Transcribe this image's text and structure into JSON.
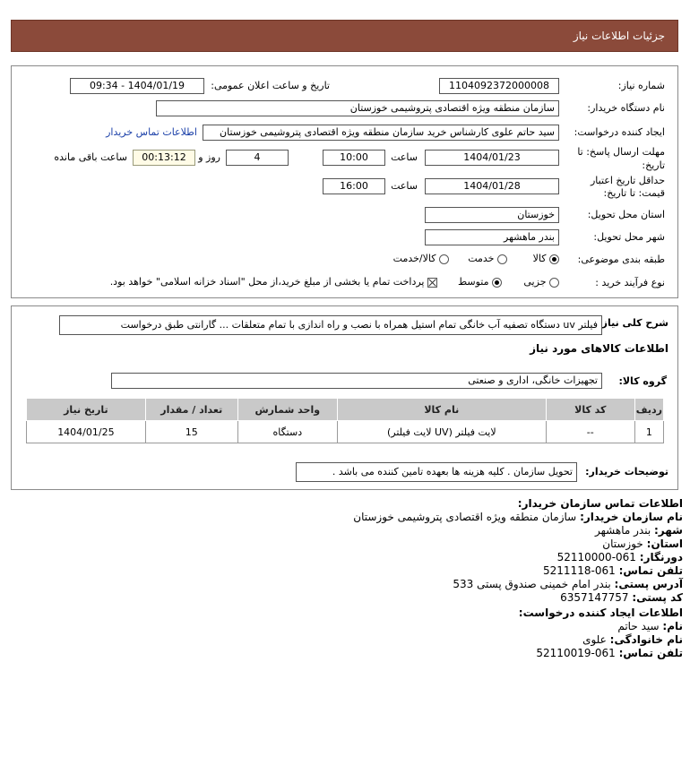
{
  "header": {
    "title": "جزئیات اطلاعات نیاز"
  },
  "details": {
    "need_number_label": "شماره نیاز:",
    "need_number": "1104092372000008",
    "announce_label": "تاریخ و ساعت اعلان عمومی:",
    "announce_value": "1404/01/19 - 09:34",
    "buyer_org_label": "نام دستگاه خریدار:",
    "buyer_org": "سازمان منطقه ویژه اقتصادی پتروشیمی خوزستان",
    "creator_label": "ایجاد کننده درخواست:",
    "creator": "سید حاتم علوی کارشناس خرید سازمان منطقه ویژه اقتصادی پتروشیمی خوزستان",
    "contact_link": "اطلاعات تماس خریدار",
    "deadline_label_1": "مهلت ارسال پاسخ: تا",
    "deadline_label_2": "تاریخ:",
    "deadline_date": "1404/01/23",
    "time_label": "ساعت",
    "deadline_time": "10:00",
    "days": "4",
    "days_label": "روز و",
    "remaining": "00:13:12",
    "remaining_label": "ساعت باقی مانده",
    "validity_label_1": "حداقل تاریخ اعتبار",
    "validity_label_2": "قیمت: تا تاریخ:",
    "validity_date": "1404/01/28",
    "validity_time": "16:00",
    "province_label": "استان محل تحویل:",
    "province": "خوزستان",
    "city_label": "شهر محل تحویل:",
    "city": "بندر ماهشهر",
    "category_label": "طبقه بندی موضوعی:",
    "category_options": [
      "کالا",
      "خدمت",
      "کالا/خدمت"
    ],
    "category_selected": "کالا",
    "process_label": "نوع فرآیند خرید :",
    "process_options": [
      "جزیی",
      "متوسط"
    ],
    "process_selected": "متوسط",
    "payment_note": "پرداخت تمام یا بخشی از مبلغ خرید،از محل \"اسناد خزانه اسلامی\" خواهد بود."
  },
  "description": {
    "label": "شرح کلی نیاز:",
    "text": "فیلتر uv دستگاه تصفیه آب خانگی تمام استیل همراه با نصب و راه اندازی با تمام متعلقات ... گارانتی طبق درخواست"
  },
  "goods": {
    "section_title": "اطلاعات کالاهای مورد نیاز",
    "group_label": "گروه کالا:",
    "group_value": "تجهیزات خانگی، اداری و صنعتی",
    "columns": [
      "ردیف",
      "کد کالا",
      "نام کالا",
      "واحد شمارش",
      "تعداد / مقدار",
      "تاریخ نیاز"
    ],
    "rows": [
      [
        "1",
        "--",
        "لایت فیلتر (UV لایت فیلتر)",
        "دستگاه",
        "15",
        "1404/01/25"
      ]
    ],
    "buyer_notes_label": "توضیحات خریدار:",
    "buyer_notes": "تحویل سازمان . کلیه هزینه ها بعهده تامین کننده می باشد ."
  },
  "contact": {
    "title": "اطلاعات تماس سازمان خریدار:",
    "org_label": "نام سازمان خریدار:",
    "org": "سازمان منطقه ویژه اقتصادی پتروشیمی خوزستان",
    "city_label": "شهر:",
    "city": "بندر ماهشهر",
    "province_label": "استان:",
    "province": "خوزستان",
    "fax_label": "دورنگار:",
    "fax": "061-52110000",
    "phone_label": "تلفن تماس:",
    "phone": "061-5211118",
    "address_label": "آدرس پستی:",
    "address": "بندر امام خمینی صندوق پستی 533",
    "postal_label": "کد پستی:",
    "postal": "6357147757",
    "creator_title": "اطلاعات ایجاد کننده درخواست:",
    "name_label": "نام:",
    "name": "سید حاتم",
    "family_label": "نام خانوادگی:",
    "family": "علوی",
    "creator_phone_label": "تلفن تماس:",
    "creator_phone": "061-52110019"
  }
}
